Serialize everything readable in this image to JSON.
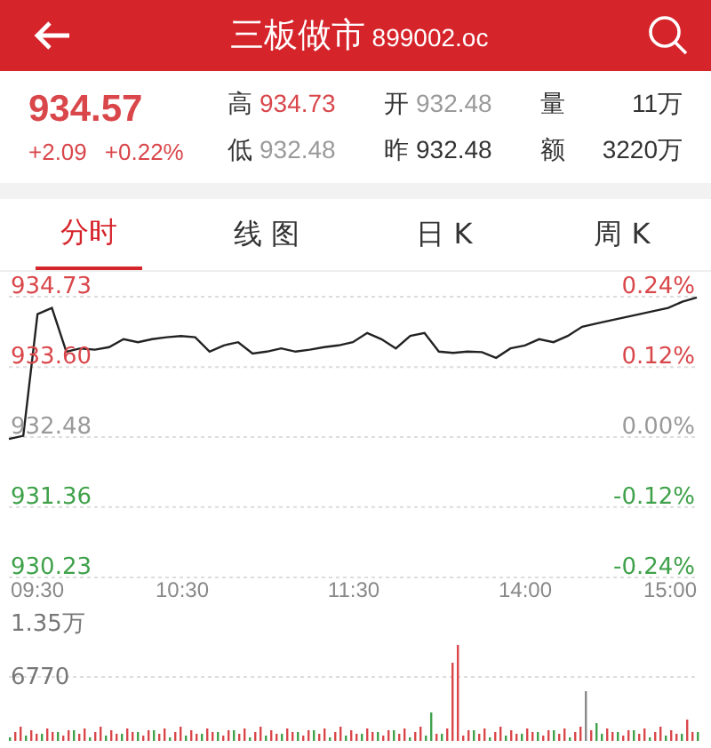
{
  "header": {
    "title": "三板做市",
    "code": "899002.oc"
  },
  "quote": {
    "price": "934.57",
    "change": "+2.09",
    "change_pct": "+0.22%",
    "color": "#d9474b"
  },
  "stats": [
    {
      "label": "高",
      "value": "934.73",
      "color": "#d9474b"
    },
    {
      "label": "开",
      "value": "932.48",
      "color": "#9a9a9a"
    },
    {
      "label": "量",
      "value": "11万",
      "color": "#333333"
    },
    {
      "label": "低",
      "value": "932.48",
      "color": "#9a9a9a"
    },
    {
      "label": "昨",
      "value": "932.48",
      "color": "#333333"
    },
    {
      "label": "额",
      "value": "3220万",
      "color": "#333333"
    }
  ],
  "tabs": [
    {
      "label": "分时",
      "selected": true
    },
    {
      "label": "线 图",
      "selected": false
    },
    {
      "label": "日 K",
      "selected": false
    },
    {
      "label": "周 K",
      "selected": false
    }
  ],
  "price_chart": {
    "chart_data": {
      "type": "line",
      "series": [
        {
          "color": "#222222",
          "values": [
            932.45,
            932.5,
            934.45,
            934.55,
            933.85,
            933.9,
            933.88,
            933.92,
            934.05,
            934.0,
            934.05,
            934.08,
            934.1,
            934.08,
            933.85,
            933.95,
            934.0,
            933.82,
            933.85,
            933.9,
            933.85,
            933.88,
            933.92,
            933.95,
            934.0,
            934.15,
            934.05,
            933.9,
            934.1,
            934.15,
            933.85,
            933.83,
            933.85,
            933.84,
            933.75,
            933.9,
            933.95,
            934.05,
            934.0,
            934.1,
            934.25,
            934.3,
            934.35,
            934.4,
            934.45,
            934.5,
            934.55,
            934.65,
            934.72
          ]
        }
      ],
      "ylim": [
        930.23,
        934.73
      ],
      "grid": true,
      "yticks": [
        {
          "value": 934.73,
          "label": "934.73"
        },
        {
          "value": 933.6,
          "label": "933.60"
        },
        {
          "value": 932.48,
          "label": "932.48"
        },
        {
          "value": 931.36,
          "label": "931.36"
        },
        {
          "value": 930.23,
          "label": "930.23"
        }
      ]
    },
    "right_labels": [
      {
        "text": "0.24%",
        "color": "#d9474b"
      },
      {
        "text": "0.12%",
        "color": "#d9474b"
      },
      {
        "text": "0.00%",
        "color": "#9a9a9a"
      },
      {
        "text": "-0.12%",
        "color": "#3fa14a"
      },
      {
        "text": "-0.24%",
        "color": "#3fa14a"
      }
    ],
    "time_labels": [
      "09:30",
      "10:30",
      "11:30",
      "14:00",
      "15:00"
    ]
  },
  "volume_chart": {
    "labels": [
      "1.35万",
      "6770"
    ]
  }
}
